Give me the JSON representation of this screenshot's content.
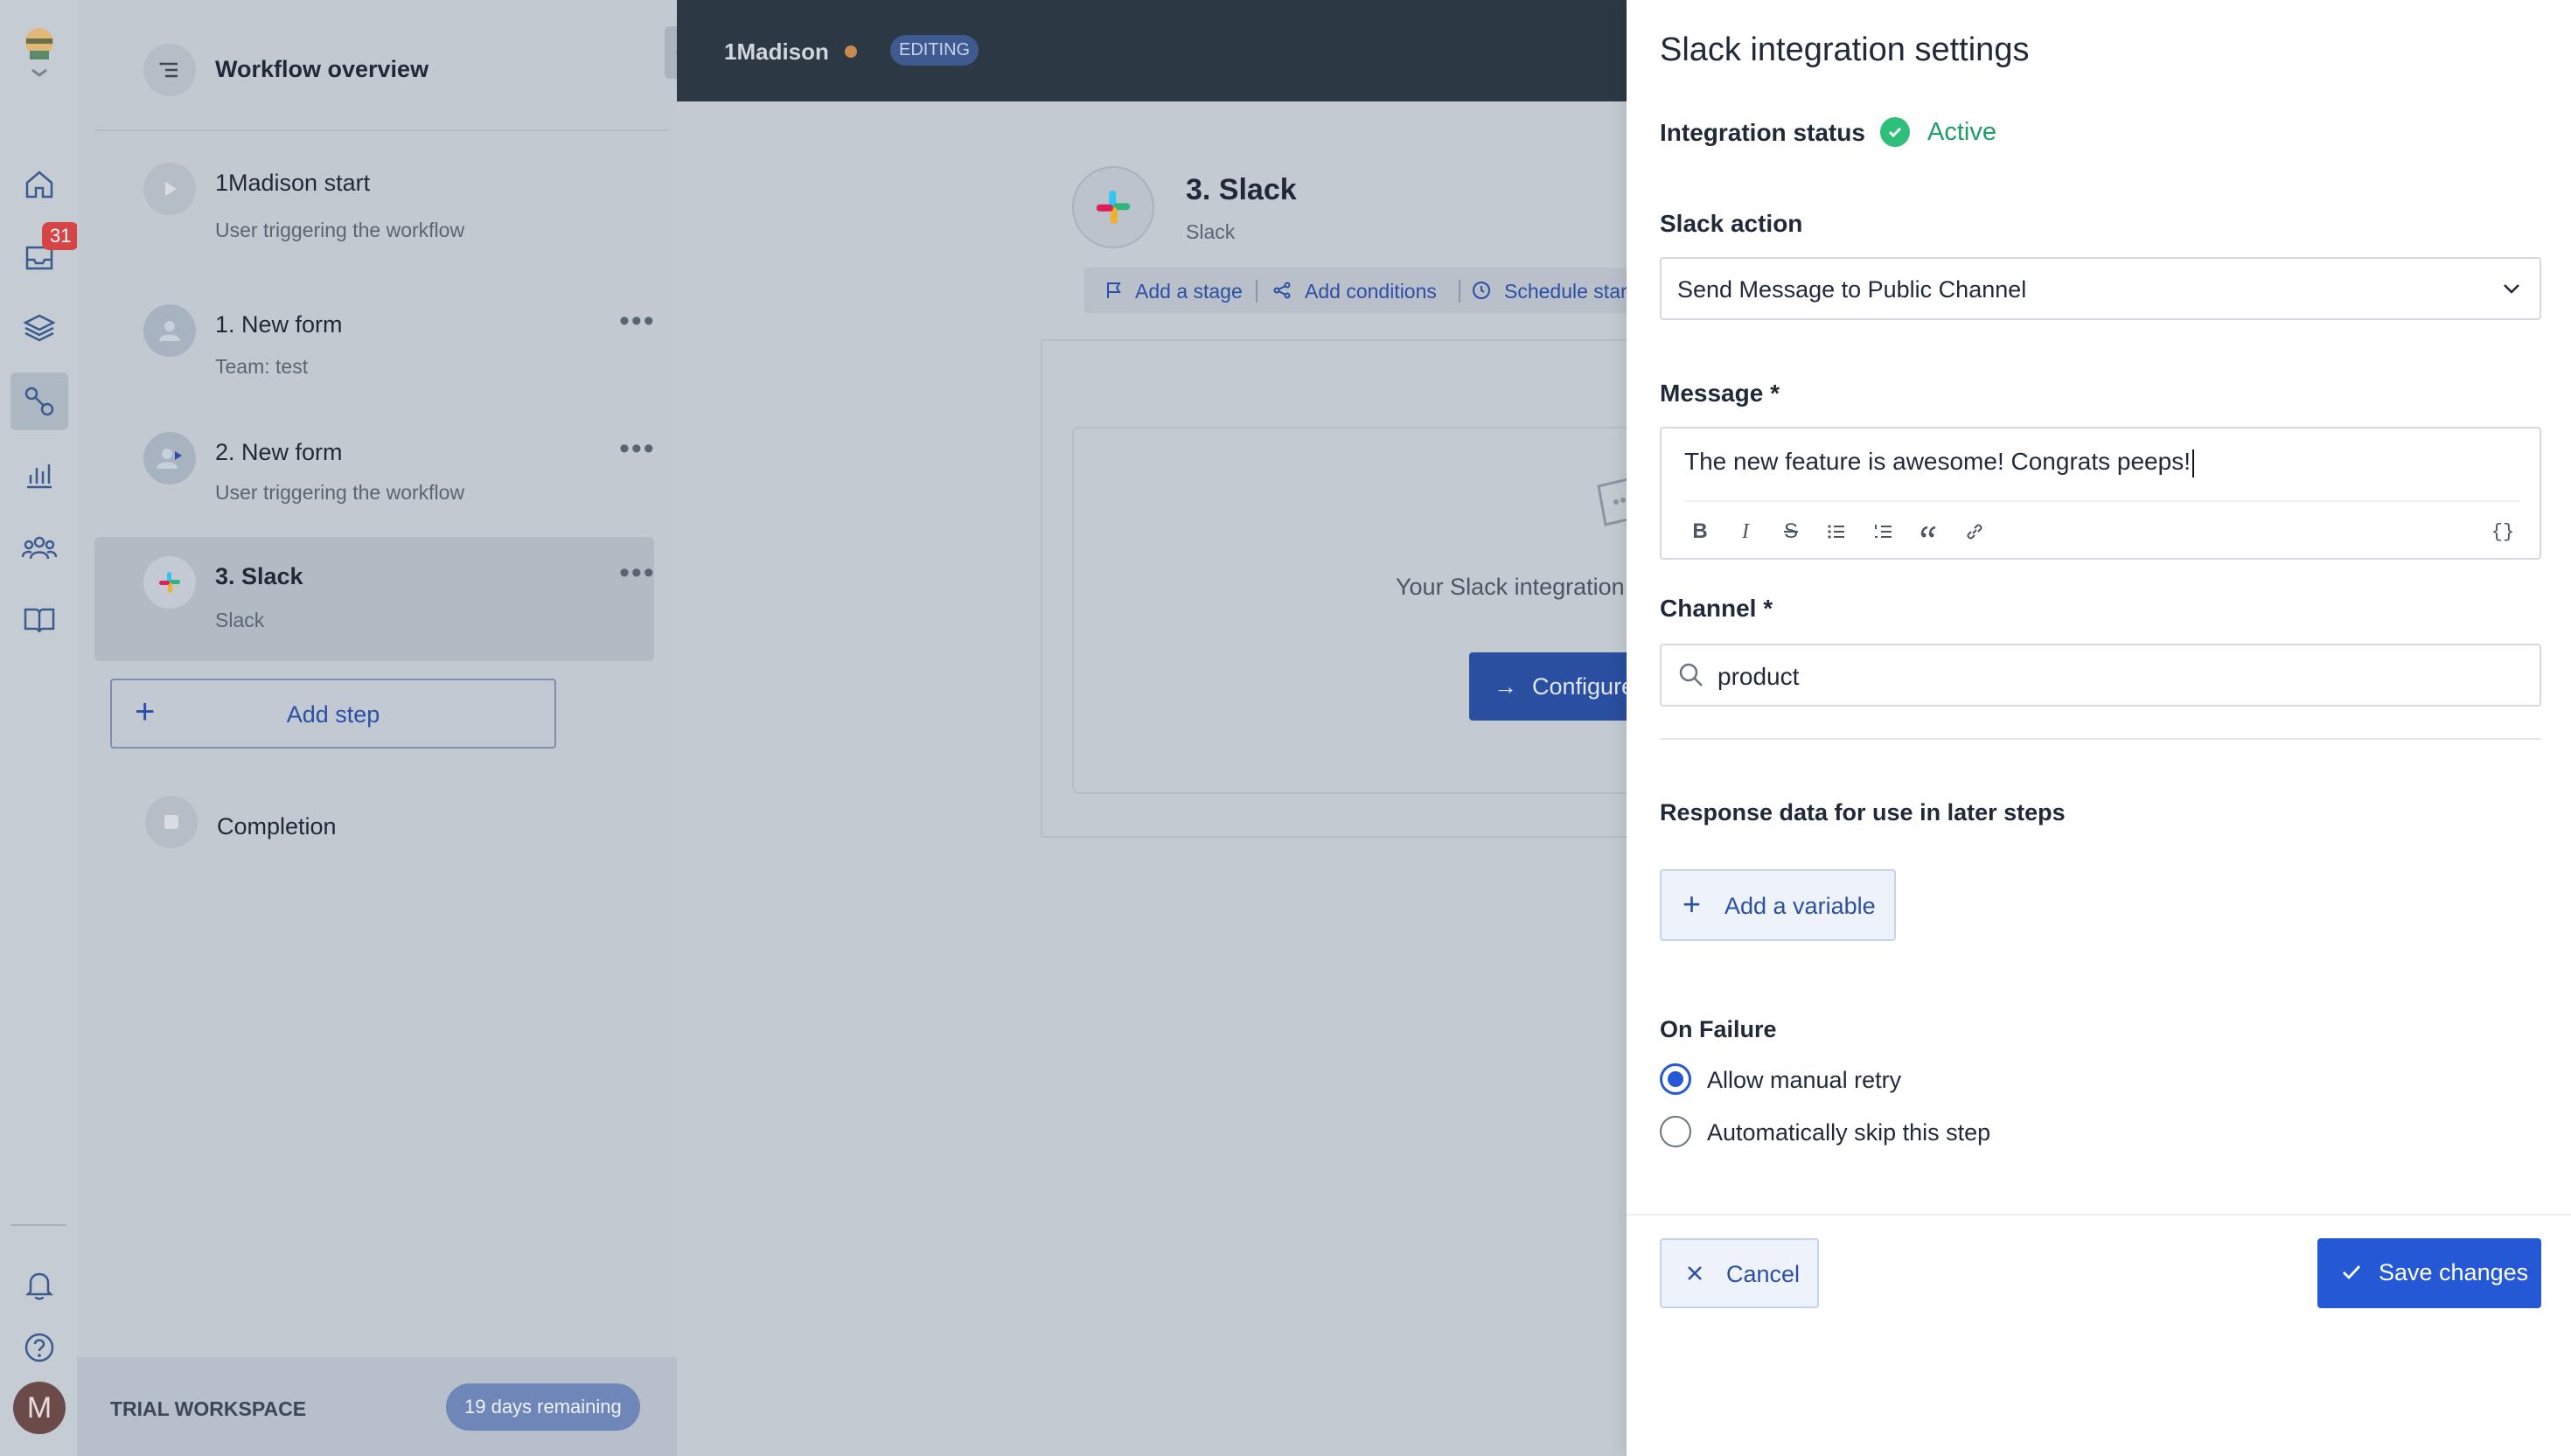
{
  "rail": {
    "inbox_badge": "31",
    "avatar_initial": "M",
    "icons": [
      "home-icon",
      "inbox-icon",
      "layers-icon",
      "workflow-icon",
      "chart-icon",
      "users-icon",
      "book-icon",
      "bell-icon",
      "help-icon"
    ]
  },
  "steps_panel": {
    "header_title": "Workflow overview",
    "steps": [
      {
        "name": "1Madison start",
        "sub": "User triggering the workflow"
      },
      {
        "name": "1. New form",
        "sub": "Team: test"
      },
      {
        "name": "2. New form",
        "sub": "User triggering the workflow"
      },
      {
        "name": "3. Slack",
        "sub": "Slack"
      }
    ],
    "add_step_label": "Add step",
    "completion_label": "Completion",
    "trial_label": "TRIAL WORKSPACE",
    "trial_pill": "19 days remaining"
  },
  "topbar": {
    "workspace": "1Madison",
    "mode_badge": "EDITING"
  },
  "canvas": {
    "step_title": "3. Slack",
    "step_sub": "Slack",
    "toolbar": [
      "Add a stage",
      "Add conditions",
      "Schedule start"
    ],
    "configured_text": "Your Slack integration",
    "configure_button": "Configure"
  },
  "drawer": {
    "title": "Slack integration settings",
    "status_label": "Integration status",
    "status_value": "Active",
    "action_label": "Slack action",
    "action_value": "Send Message to Public Channel",
    "message_label": "Message *",
    "message_value": "The new feature is awesome! Congrats peeps!",
    "format_tools": [
      "B",
      "I",
      "S",
      "bullet-list",
      "numbered-list",
      "quote",
      "link",
      "{}"
    ],
    "channel_label": "Channel *",
    "channel_value": "product",
    "response_label": "Response data for use in later steps",
    "add_variable_label": "Add a variable",
    "failure_label": "On Failure",
    "failure_options": [
      {
        "label": "Allow manual retry",
        "selected": true
      },
      {
        "label": "Automatically skip this step",
        "selected": false
      }
    ],
    "cancel_label": "Cancel",
    "save_label": "Save changes"
  },
  "colors": {
    "primary": "#2458d4",
    "active_green": "#2ebf7a",
    "topbar_bg": "#2c3844"
  }
}
